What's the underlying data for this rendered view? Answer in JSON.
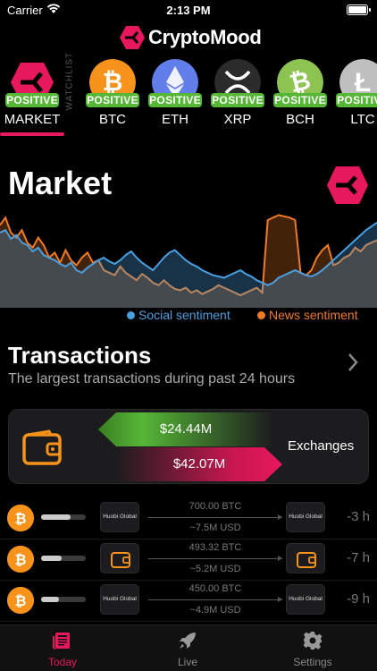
{
  "status": {
    "carrier": "Carrier",
    "time": "2:13 PM"
  },
  "app": {
    "title": "CryptoMood"
  },
  "watchlist_label": "WATCHLIST",
  "coins": [
    {
      "label": "MARKET",
      "badge": "POSITIVE",
      "color": "#e8185e"
    },
    {
      "label": "BTC",
      "badge": "POSITIVE",
      "color": "#f7931a"
    },
    {
      "label": "ETH",
      "badge": "POSITIVE",
      "color": "#627eea"
    },
    {
      "label": "XRP",
      "badge": "POSITIVE",
      "color": "#2b2b2b"
    },
    {
      "label": "BCH",
      "badge": "POSITIVE",
      "color": "#8dc351"
    },
    {
      "label": "LTC",
      "badge": "POSITIVE",
      "color": "#bfbfbf"
    }
  ],
  "market": {
    "title": "Market"
  },
  "chart_data": {
    "type": "area",
    "series": [
      {
        "name": "Social sentiment",
        "color": "#4a9fe0",
        "values": [
          60,
          62,
          55,
          58,
          52,
          50,
          45,
          48,
          42,
          40,
          38,
          35,
          33,
          36,
          30,
          28,
          32,
          35,
          38,
          40,
          37,
          35,
          38,
          42,
          45,
          40,
          36,
          33,
          30,
          35,
          40,
          44,
          46,
          42,
          38,
          35,
          33,
          30,
          28,
          26,
          25,
          24,
          26,
          28,
          30,
          27,
          25,
          22,
          20,
          18,
          20,
          24,
          26,
          28,
          30,
          28,
          26,
          25,
          27,
          30,
          34,
          38,
          42,
          46,
          50,
          54,
          58,
          62,
          65,
          68
        ]
      },
      {
        "name": "News sentiment",
        "color": "#f07b24",
        "values": [
          66,
          72,
          60,
          56,
          62,
          52,
          48,
          56,
          50,
          40,
          44,
          36,
          46,
          38,
          34,
          40,
          44,
          36,
          38,
          30,
          28,
          26,
          33,
          28,
          25,
          22,
          27,
          24,
          20,
          18,
          22,
          18,
          15,
          14,
          16,
          12,
          14,
          11,
          13,
          15,
          18,
          16,
          14,
          12,
          10,
          12,
          14,
          16,
          12,
          70,
          72,
          74,
          73,
          72,
          70,
          28,
          26,
          30,
          40,
          46,
          50,
          34,
          36,
          40,
          42,
          48,
          45,
          50,
          52,
          54
        ]
      }
    ],
    "legend": "bottom-right",
    "grid": false
  },
  "transactions": {
    "title": "Transactions",
    "subtitle": "The largest transactions during past 24 hours",
    "inflow": "$24.44M",
    "outflow": "$42.07M",
    "exchanges_label": "Exchanges",
    "rows": [
      {
        "from": "Huobi Global",
        "to": "Huobi Global",
        "amount": "700.00 BTC",
        "usd": "~7.5M USD",
        "ago": "-3 h",
        "level": 0.65
      },
      {
        "from": "wallet",
        "to": "wallet",
        "amount": "493.32 BTC",
        "usd": "~5.2M USD",
        "ago": "-7 h",
        "level": 0.45
      },
      {
        "from": "Huobi Global",
        "to": "Huobi Global",
        "amount": "450.00 BTC",
        "usd": "~4.9M USD",
        "ago": "-9 h",
        "level": 0.4
      }
    ]
  },
  "tabs": [
    {
      "label": "Today",
      "active": true
    },
    {
      "label": "Live",
      "active": false
    },
    {
      "label": "Settings",
      "active": false
    }
  ]
}
